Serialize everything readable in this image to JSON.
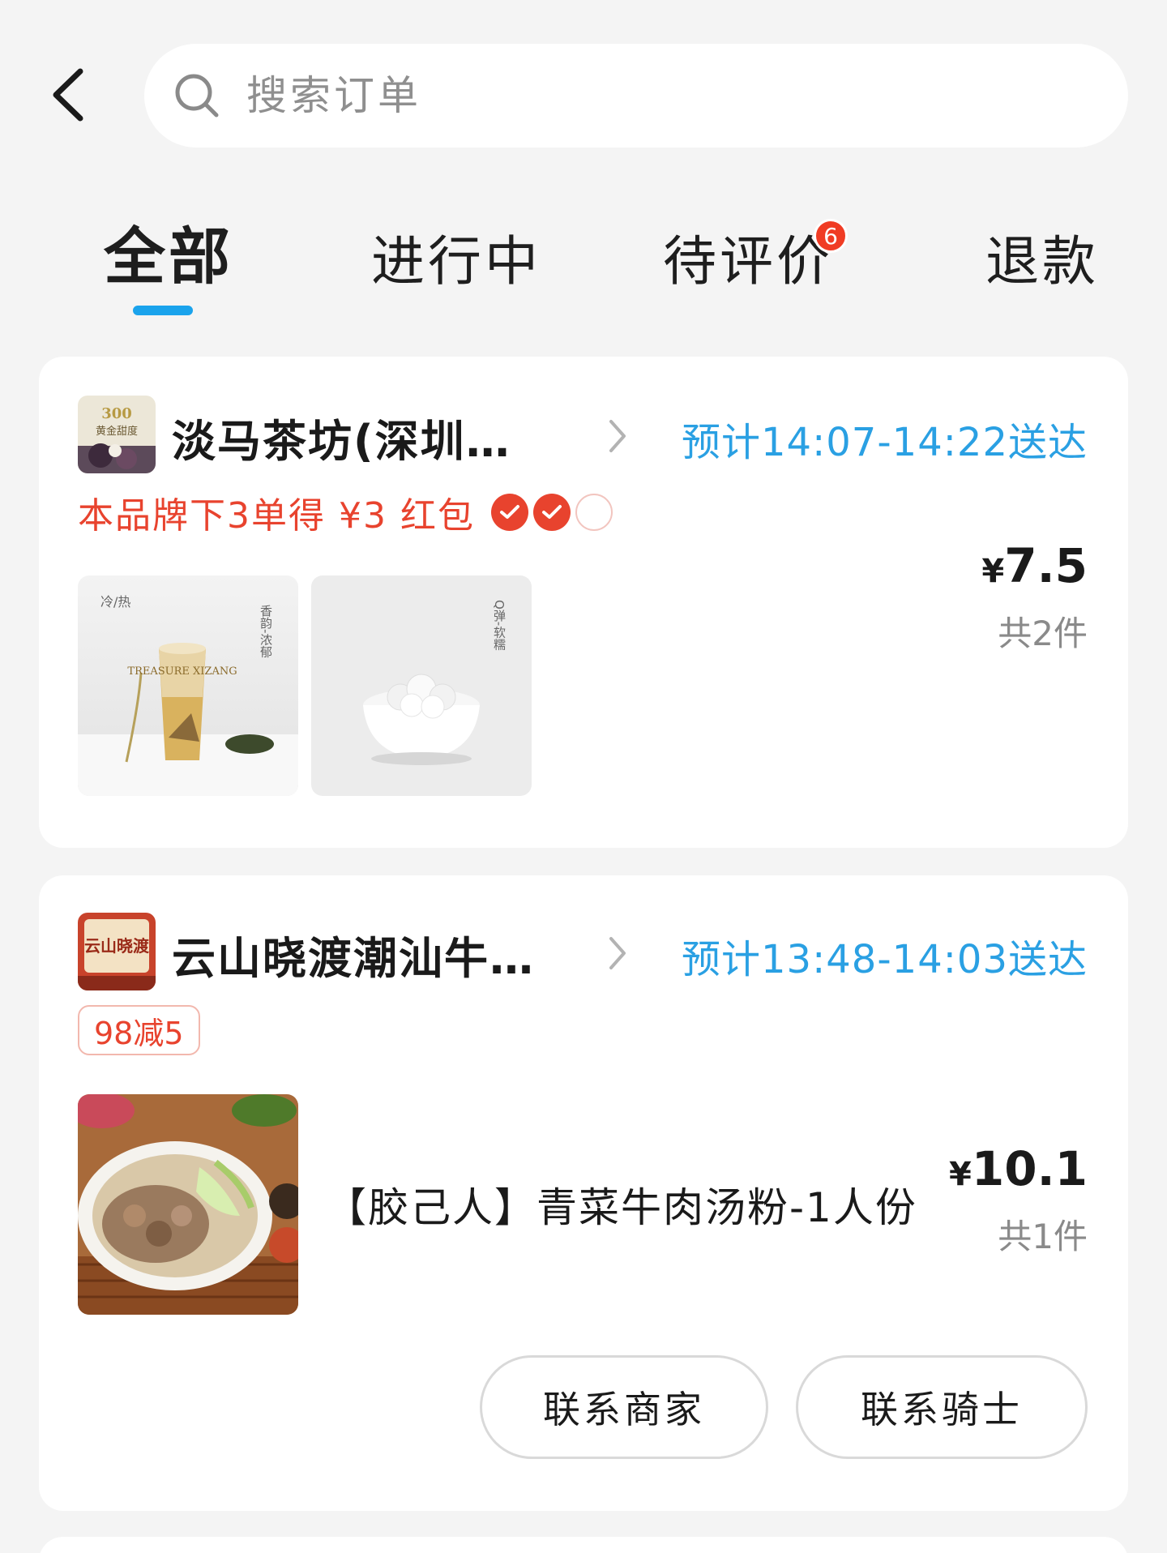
{
  "search": {
    "placeholder": "搜索订单"
  },
  "tabs": [
    {
      "label": "全部",
      "active": true
    },
    {
      "label": "进行中",
      "active": false
    },
    {
      "label": "待评价",
      "active": false,
      "badge": "6"
    },
    {
      "label": "退款",
      "active": false
    }
  ],
  "orders": [
    {
      "store_name": "淡马茶坊(深圳…",
      "eta": "预计14:07-14:22送达",
      "promo_text": "本品牌下3单得 ¥3 红包",
      "promo_progress": {
        "done": 2,
        "total": 3
      },
      "logo_text": {
        "top": "300",
        "main": "黄金甜度"
      },
      "thumbs": [
        {
          "left_text": "冷/热",
          "right_text": "香韵-浓郁",
          "label": "TREASURE XIZANG"
        },
        {
          "right_text": "Q弹-软糯"
        }
      ],
      "currency": "¥",
      "price": "7.5",
      "count": "共2件"
    },
    {
      "store_name": "云山晓渡潮汕牛…",
      "eta": "预计13:48-14:03送达",
      "coupon": "98减5",
      "logo_text": "云山晓渡",
      "item_name": "【胶己人】青菜牛肉汤粉-1人份",
      "currency": "¥",
      "price": "10.1",
      "count": "共1件",
      "buttons": {
        "contact_merchant": "联系商家",
        "contact_rider": "联系骑士"
      }
    }
  ],
  "colors": {
    "accent": "#1aa3ec",
    "eta": "#2aa0e3",
    "promo": "#e8432e",
    "badge": "#f03c24"
  }
}
